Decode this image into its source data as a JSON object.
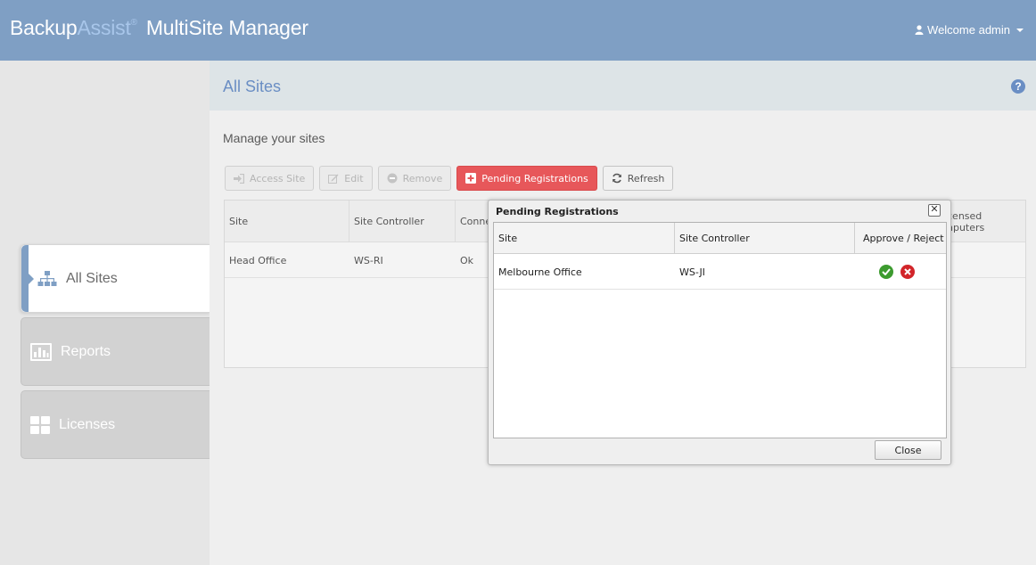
{
  "header": {
    "brand_part1": "Backup",
    "brand_part2": "Assist",
    "brand_tm": "®",
    "brand_product": "MultiSite Manager",
    "welcome": "Welcome admin",
    "bar_color": "#7f9fc4"
  },
  "sidebar": {
    "items": [
      {
        "label": "All Sites",
        "icon": "sitemap-icon",
        "active": true
      },
      {
        "label": "Reports",
        "icon": "bar-chart-icon",
        "active": false
      },
      {
        "label": "Licenses",
        "icon": "grid-icon",
        "active": false
      }
    ]
  },
  "main": {
    "title": "All Sites",
    "subtitle": "Manage your sites",
    "toolbar": {
      "access_site": "Access Site",
      "edit": "Edit",
      "remove": "Remove",
      "pending": "Pending Registrations",
      "refresh": "Refresh"
    },
    "sites_table": {
      "headers": {
        "site": "Site",
        "controller": "Site Controller",
        "connection": "Conne",
        "licensed_1": "censed",
        "licensed_2": "nputers"
      },
      "rows": [
        {
          "site": "Head Office",
          "controller": "WS-RI",
          "connection": "Ok"
        }
      ]
    }
  },
  "modal": {
    "title": "Pending Registrations",
    "close_x": "✕",
    "columns": {
      "site": "Site",
      "controller": "Site Controller",
      "approve_reject": "Approve / Reject"
    },
    "rows": [
      {
        "site": "Melbourne Office",
        "controller": "WS-JI"
      }
    ],
    "close_label": "Close"
  }
}
